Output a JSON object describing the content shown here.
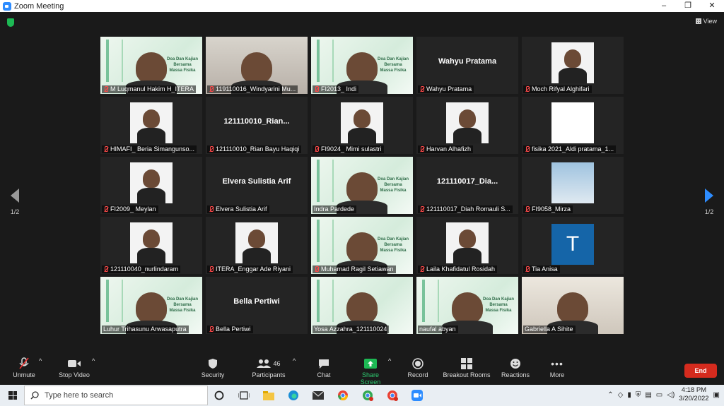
{
  "window": {
    "title": "Zoom Meeting",
    "controls": [
      "–",
      "❐",
      "✕"
    ]
  },
  "view": {
    "label": "View"
  },
  "pager": {
    "left": "1/2",
    "right": "1/2"
  },
  "tiles": [
    {
      "name": "M Luqmanul Hakim H_ITERA",
      "kind": "video",
      "bg": "green",
      "overlay": "Doa Dan Kajian Bersama Massa Fisika"
    },
    {
      "name": "119110016_Windyarini Mu...",
      "kind": "video",
      "bg": "wall"
    },
    {
      "name": "FI2013_ Indi",
      "kind": "video",
      "bg": "green",
      "overlay": "Doa Dan Kajian Bersama Massa Fisika"
    },
    {
      "name": "Wahyu Pratama",
      "kind": "name",
      "big": "Wahyu Pratama"
    },
    {
      "name": "Moch Rifyal Alghifari",
      "kind": "photo"
    },
    {
      "name": "HIMAFI_ Beria Simangunso...",
      "kind": "photo"
    },
    {
      "name": "121110010_Rian Bayu Haqiqi",
      "kind": "name",
      "big": "121110010_Rian..."
    },
    {
      "name": "FI9024_ Mimi sulastri",
      "kind": "photo"
    },
    {
      "name": "Harvan Alhafizh",
      "kind": "photo"
    },
    {
      "name": "fisika 2021_Aldi pratama_1...",
      "kind": "photo-white"
    },
    {
      "name": "FI2009_ Meylan",
      "kind": "photo"
    },
    {
      "name": "Elvera Sulistia Arif",
      "kind": "name",
      "big": "Elvera Sulistia Arif"
    },
    {
      "name": "Indra Pardede",
      "kind": "video",
      "bg": "green",
      "overlay": "Doa Dan Kajian Bersama Massa Fisika"
    },
    {
      "name": "121110017_Diah Romauli S...",
      "kind": "name",
      "big": "121110017_Dia..."
    },
    {
      "name": "FI9058_Mirza",
      "kind": "photo-sky"
    },
    {
      "name": "121110040_nurlindaram",
      "kind": "photo"
    },
    {
      "name": "ITERA_Enggar Ade Riyani",
      "kind": "photo"
    },
    {
      "name": "Muhamad Ragil Setiawan",
      "kind": "video",
      "bg": "green",
      "overlay": "Doa Dan Kajian Bersama Massa Fisika"
    },
    {
      "name": "Laila Khafidatul Rosidah",
      "kind": "photo"
    },
    {
      "name": "Tia Anisa",
      "kind": "letter",
      "letter": "T"
    },
    {
      "name": "Luhur Trihasunu Arwasaputra",
      "kind": "video",
      "bg": "green",
      "active": true,
      "overlay": "Doa Dan Kajian Bersama Massa Fisika"
    },
    {
      "name": "Bella Pertiwi",
      "kind": "name",
      "big": "Bella Pertiwi"
    },
    {
      "name": "Yosa Azzahra_121110024",
      "kind": "video",
      "bg": "green"
    },
    {
      "name": "naufal abyan",
      "kind": "video",
      "bg": "green",
      "overlay": "Doa Dan Kajian Bersama Massa Fisika"
    },
    {
      "name": "Gabriella A Sihite",
      "kind": "video",
      "bg": "room"
    }
  ],
  "toolbar": {
    "unmute": "Unmute",
    "stop_video": "Stop Video",
    "security": "Security",
    "participants": "Participants",
    "participants_count": "46",
    "chat": "Chat",
    "share_screen": "Share Screen",
    "record": "Record",
    "breakout": "Breakout Rooms",
    "reactions": "Reactions",
    "more": "More",
    "end": "End"
  },
  "taskbar": {
    "search_placeholder": "Type here to search",
    "time": "4:18 PM",
    "date": "3/20/2022"
  },
  "colors": {
    "accent": "#2d8cff",
    "end": "#d52b1e",
    "share": "#1db954",
    "active_border": "#b9d33a"
  }
}
